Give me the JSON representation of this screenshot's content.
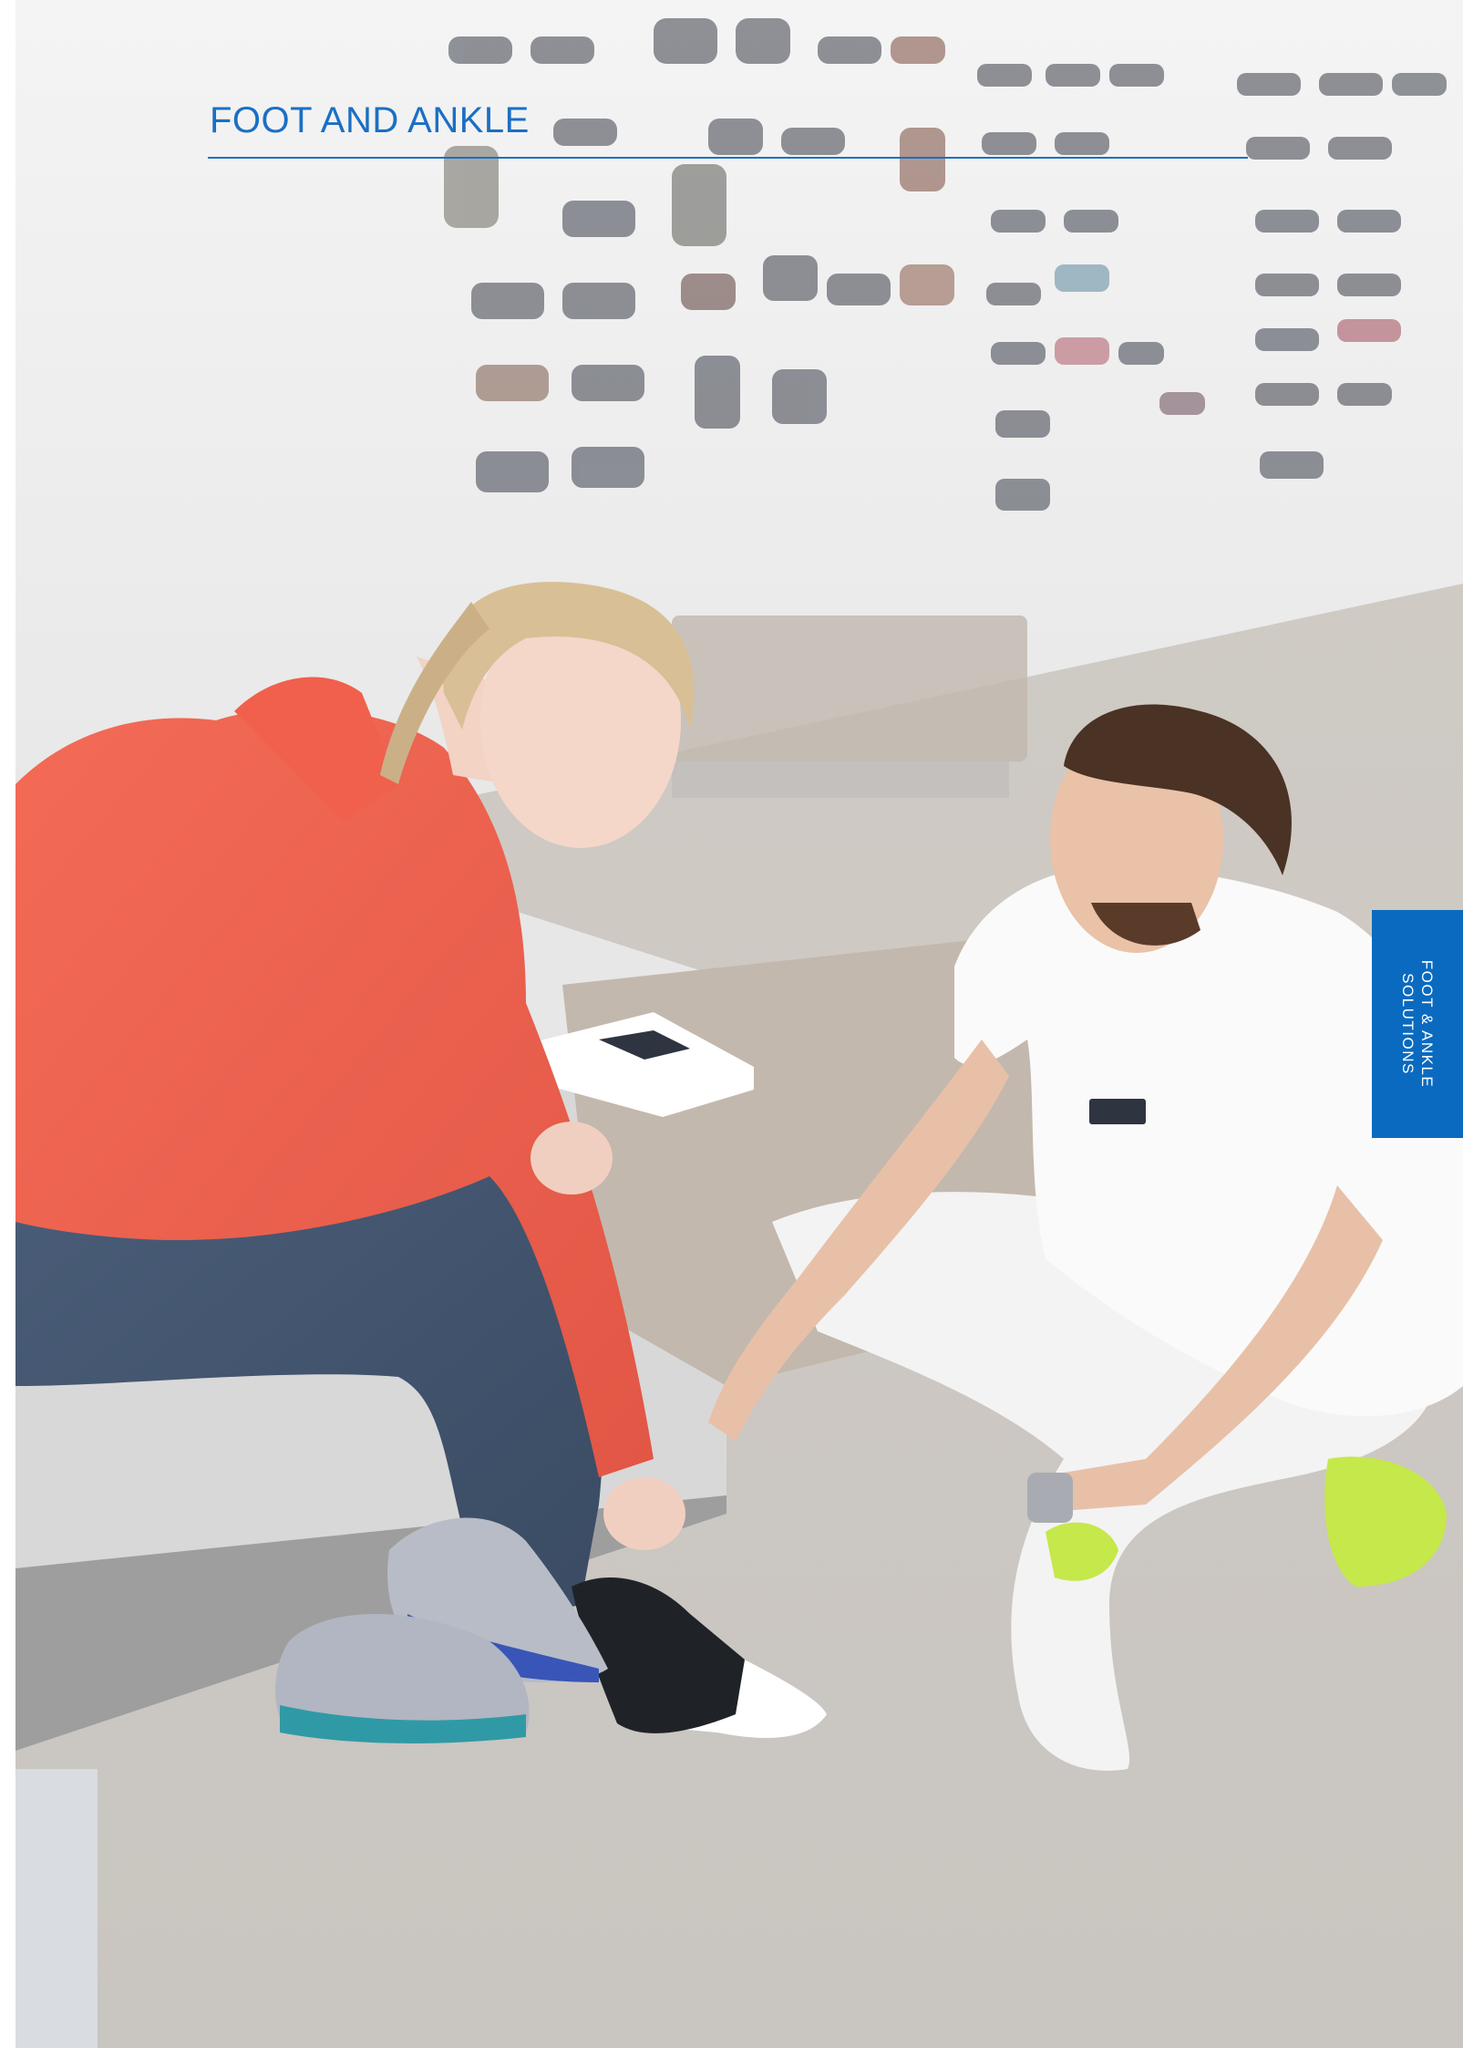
{
  "header": {
    "section_title": "FOOT AND ANKLE"
  },
  "side_tab": {
    "line1": "FOOT & ANKLE",
    "line2": "SOLUTIONS"
  },
  "colors": {
    "accent": "#1b6fc4",
    "tab_background": "#0a6abf"
  }
}
